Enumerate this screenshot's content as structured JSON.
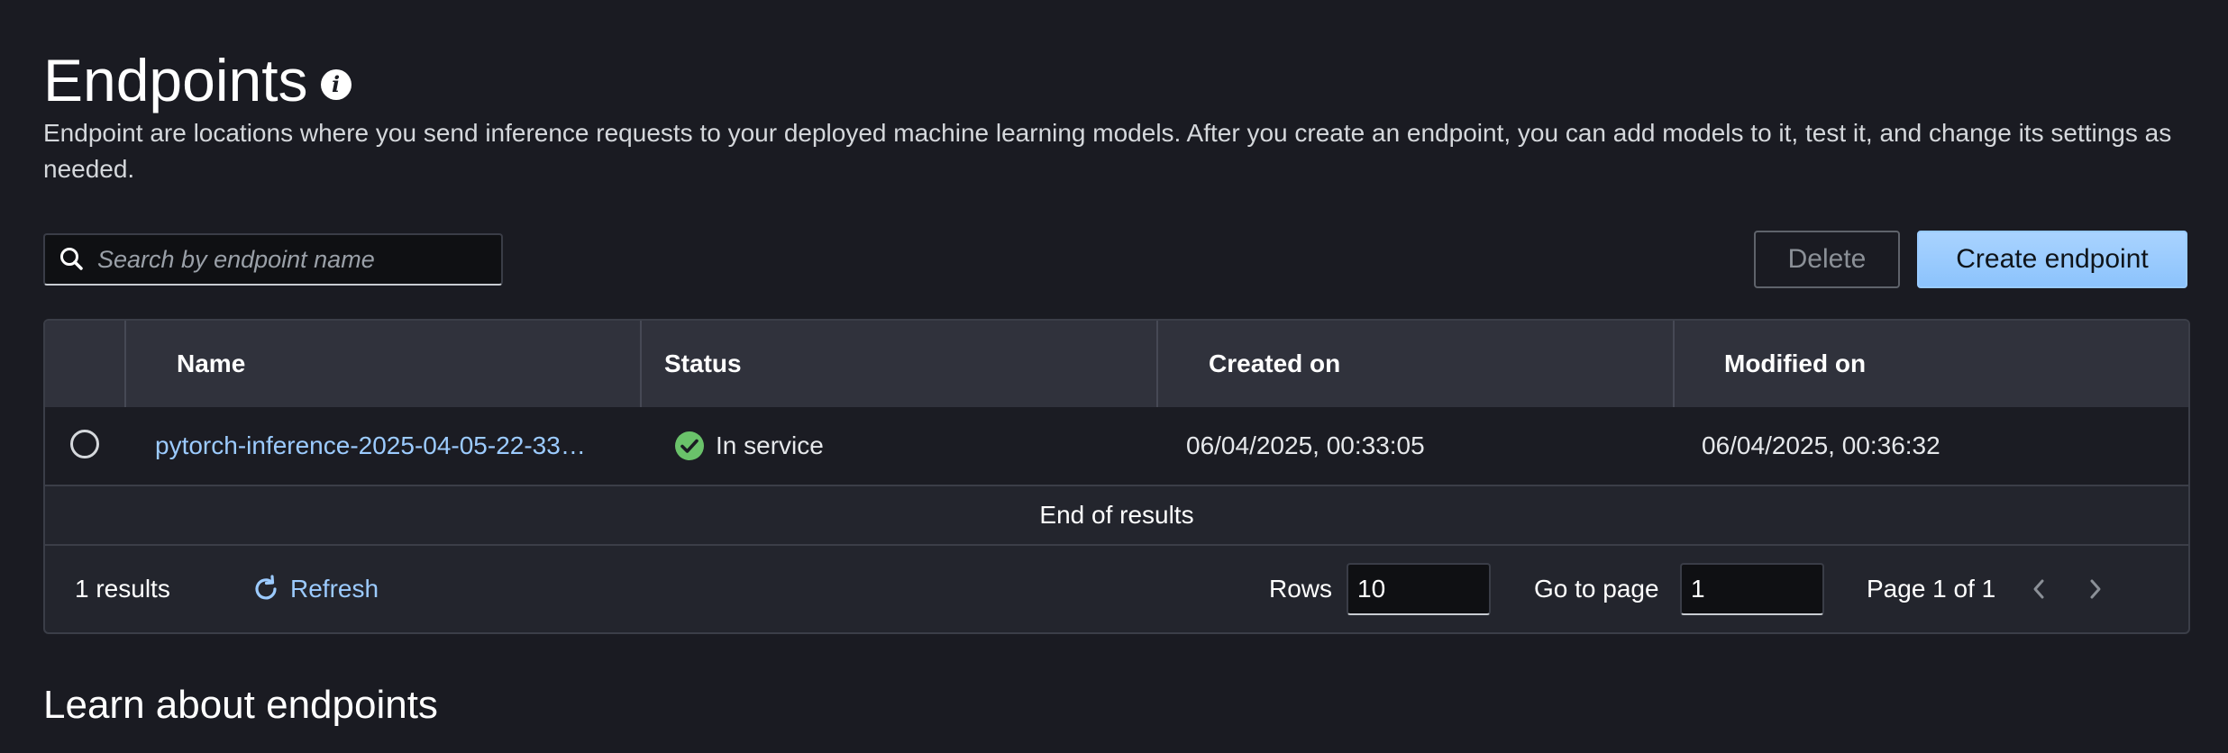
{
  "header": {
    "title": "Endpoints",
    "info_icon": "info-icon",
    "description": "Endpoint are locations where you send inference requests to your deployed machine learning models. After you create an endpoint, you can add models to it, test it, and change its settings as needed."
  },
  "search": {
    "placeholder": "Search by endpoint name",
    "value": "",
    "icon": "search-icon"
  },
  "actions": {
    "delete_label": "Delete",
    "create_label": "Create endpoint"
  },
  "table": {
    "columns": [
      "Name",
      "Status",
      "Created on",
      "Modified on"
    ],
    "rows": [
      {
        "name": "pytorch-inference-2025-04-05-22-33…",
        "status": "In service",
        "status_icon": "check-circle-icon",
        "created_on": "06/04/2025, 00:33:05",
        "modified_on": "06/04/2025, 00:36:32"
      }
    ],
    "end_text": "End of results"
  },
  "footer": {
    "results": "1 results",
    "refresh_label": "Refresh",
    "refresh_icon": "refresh-icon",
    "rows_label": "Rows",
    "rows_value": "10",
    "goto_label": "Go to page",
    "goto_value": "1",
    "page_label": "Page 1 of 1"
  },
  "learn": {
    "title": "Learn about endpoints"
  },
  "colors": {
    "background": "#1a1b22",
    "link": "#9ccbff",
    "primary_button": "#99cbff",
    "success": "#6ac26a"
  }
}
